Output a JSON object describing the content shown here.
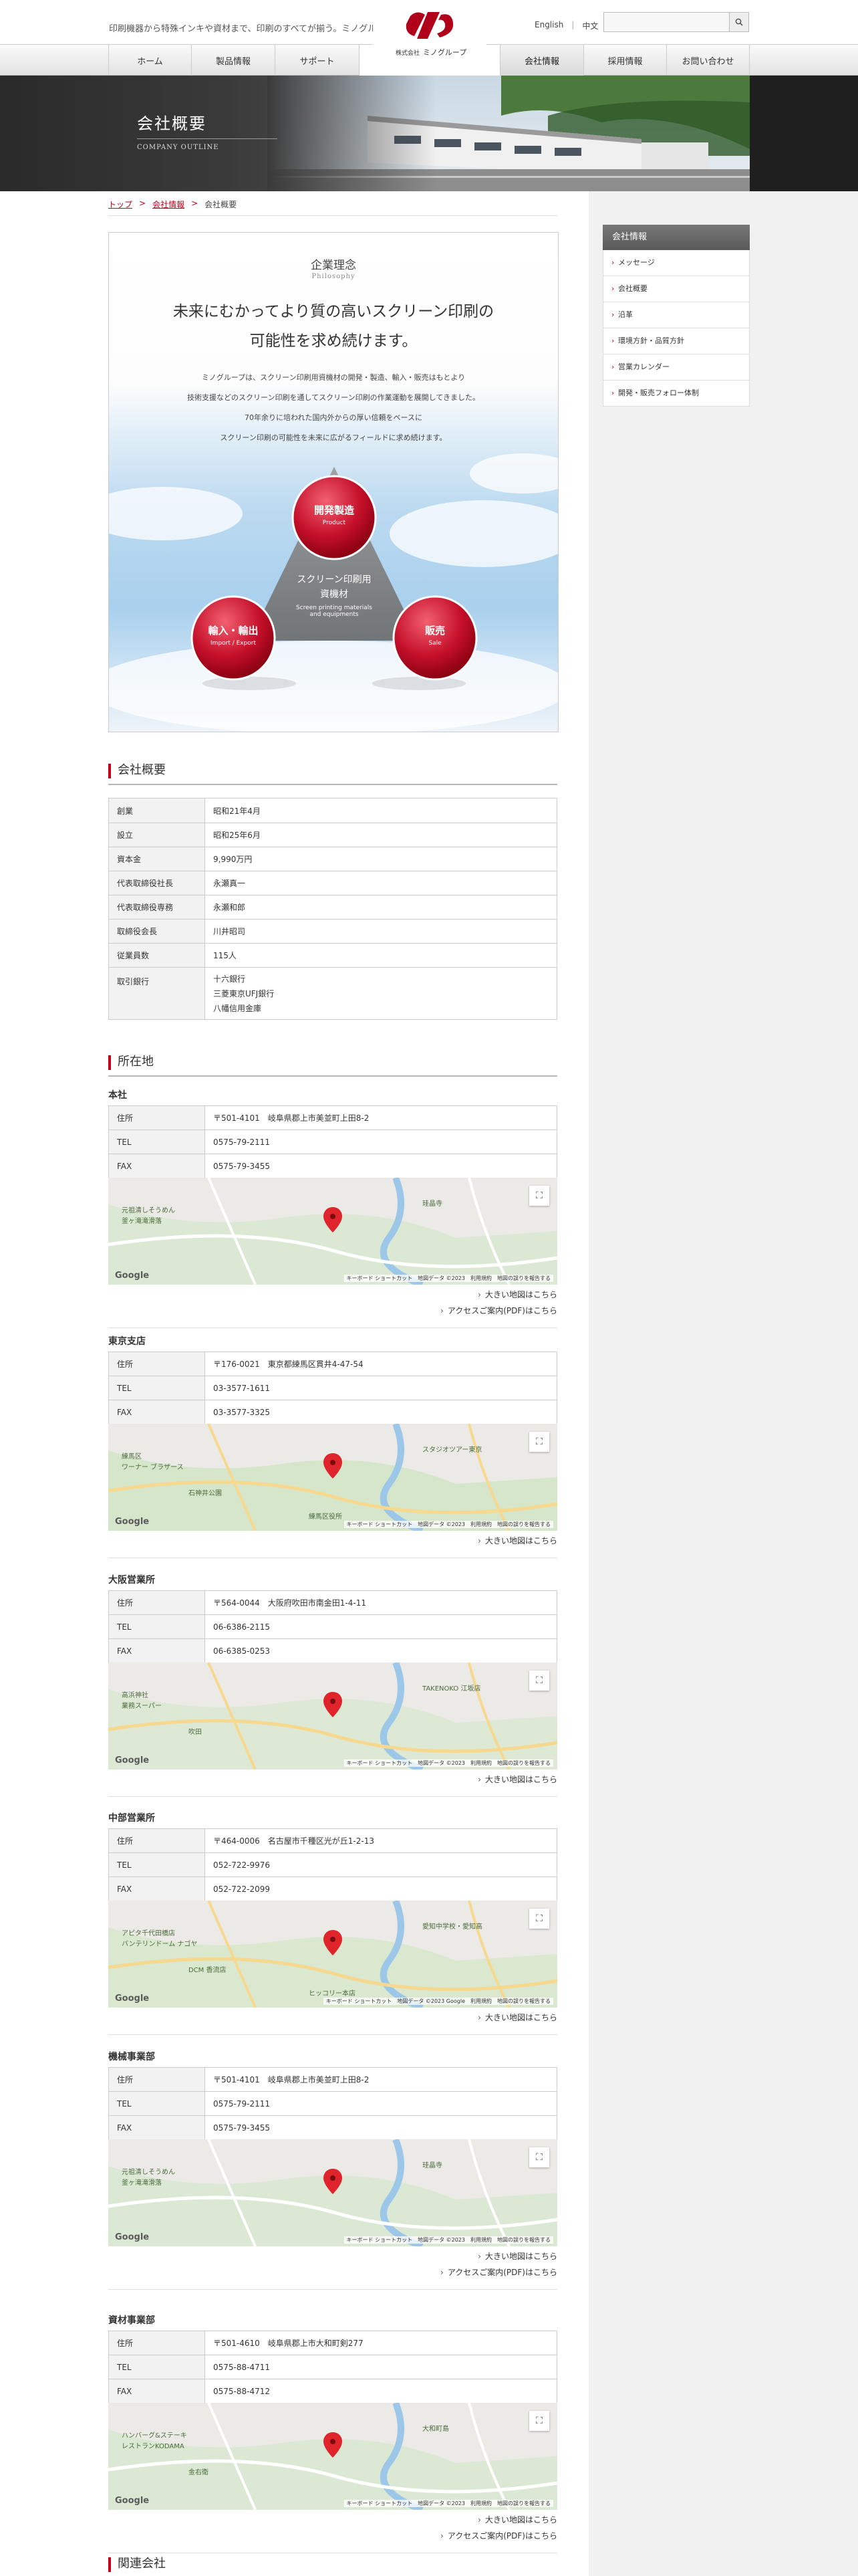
{
  "header": {
    "tagline": "印刷機器から特殊インキや資材まで、印刷のすべてが揃う。ミノグループ",
    "logo_small": "株式会社",
    "logo_text": "ミノグループ",
    "lang_en": "English",
    "lang_zh": "中文",
    "search_placeholder": ""
  },
  "nav": {
    "items": [
      {
        "label": "ホーム"
      },
      {
        "label": "製品情報"
      },
      {
        "label": "サポート"
      },
      {
        "label": "会社情報"
      },
      {
        "label": "採用情報"
      },
      {
        "label": "お問い合わせ"
      }
    ]
  },
  "hero": {
    "title": "会社概要",
    "subtitle": "COMPANY OUTLINE"
  },
  "breadcrumb": {
    "home": "トップ",
    "parent": "会社情報",
    "current": "会社概要"
  },
  "philosophy": {
    "heading": "企業理念",
    "heading_en": "Philosophy",
    "headline_1": "未来にむかってより質の高いスクリーン印刷の",
    "headline_2": "可能性を求め続けます。",
    "body": [
      "ミノグループは、スクリーン印刷用資機材の開発・製造、輸入・販売はもとより",
      "技術支援などのスクリーン印刷を通してスクリーン印刷の作業運動を展開してきました。",
      "70年余りに培われた国内外からの厚い信頼をベースに",
      "スクリーン印刷の可能性を未来に広がるフィールドに求め続けます。"
    ],
    "center_1": "スクリーン印刷用",
    "center_2": "資機材",
    "center_en_1": "Screen printing materials",
    "center_en_2": "and equipments",
    "circle_top": "開発製造",
    "circle_top_en": "Product",
    "circle_left": "輸入・輸出",
    "circle_left_en": "Import / Export",
    "circle_right": "販売",
    "circle_right_en": "Sale"
  },
  "company": {
    "heading": "会社概要",
    "rows": [
      {
        "k": "創業",
        "v": [
          "昭和21年4月"
        ]
      },
      {
        "k": "設立",
        "v": [
          "昭和25年6月"
        ]
      },
      {
        "k": "資本金",
        "v": [
          "9,990万円"
        ]
      },
      {
        "k": "代表取締役社長",
        "v": [
          "永瀬真一"
        ]
      },
      {
        "k": "代表取締役専務",
        "v": [
          "永瀬和郎"
        ]
      },
      {
        "k": "取締役会長",
        "v": [
          "川井昭司"
        ]
      },
      {
        "k": "従業員数",
        "v": [
          "115人"
        ]
      },
      {
        "k": "取引銀行",
        "v": [
          "十六銀行",
          "三菱東京UFJ銀行",
          "八幡信用金庫"
        ]
      }
    ]
  },
  "location": {
    "heading": "所在地",
    "map_google": "Google",
    "map_footer": "キーボード ショートカット　地図データ ©2023　利用規約　地図の誤りを報告する",
    "map_footer_alt": "キーボード ショートカット　地図データ ©2023 Google　利用規約　地図の誤りを報告する",
    "branches": [
      {
        "title": "本社",
        "address": "〒501-4101　岐阜県郡上市美並町上田8-2",
        "tel": "0575-79-2111",
        "fax": "0575-79-3455",
        "labels": [
          "元祖清しそうめん",
          "釜ヶ滝滝滑落",
          "珪晶寺"
        ],
        "links": [
          "大きい地図はこちら",
          "アクセスご案内(PDF)はこちら"
        ]
      },
      {
        "title": "東京支店",
        "address": "〒176-0021　東京都練馬区貫井4-47-54",
        "tel": "03-3577-1611",
        "fax": "03-3577-3325",
        "labels": [
          "練馬区",
          "ワーナー ブラザース",
          "スタジオツアー東京",
          "石神井公園",
          "練馬区役所"
        ],
        "links": [
          "大きい地図はこちら"
        ]
      },
      {
        "title": "大阪営業所",
        "address": "〒564-0044　大阪府吹田市南金田1-4-11",
        "tel": "06-6386-2115",
        "fax": "06-6385-0253",
        "labels": [
          "高浜神社",
          "業務スーパー",
          "TAKENOKO 江坂店",
          "吹田"
        ],
        "links": [
          "大きい地図はこちら"
        ]
      },
      {
        "title": "中部営業所",
        "address": "〒464-0006　名古屋市千種区光が丘1-2-13",
        "tel": "052-722-9976",
        "fax": "052-722-2099",
        "labels": [
          "アピタ千代田橋店",
          "バンテリンドーム ナゴヤ",
          "愛知中学校・愛知高",
          "DCM 香流店",
          "ヒッコリー本店"
        ],
        "links": [
          "大きい地図はこちら"
        ]
      },
      {
        "title": "機械事業部",
        "address": "〒501-4101　岐阜県郡上市美並町上田8-2",
        "tel": "0575-79-2111",
        "fax": "0575-79-3455",
        "labels": [
          "元祖清しそうめん",
          "釜ヶ滝滝滑落",
          "珪晶寺"
        ],
        "links": [
          "大きい地図はこちら",
          "アクセスご案内(PDF)はこちら"
        ]
      },
      {
        "title": "資材事業部",
        "address": "〒501-4610　岐阜県郡上市大和町剣277",
        "tel": "0575-88-4711",
        "fax": "0575-88-4712",
        "labels": [
          "ハンバーグ&ステーキ",
          "レストランKODAMA",
          "大和町島",
          "金右衛"
        ],
        "links": [
          "大きい地図はこちら",
          "アクセスご案内(PDF)はこちら"
        ]
      }
    ],
    "key_address": "住所",
    "key_tel": "TEL",
    "key_fax": "FAX"
  },
  "sidebar": {
    "heading": "会社情報",
    "items": [
      {
        "label": "メッセージ"
      },
      {
        "label": "会社概要"
      },
      {
        "label": "沿革"
      },
      {
        "label": "環境方針・品質方針"
      },
      {
        "label": "営業カレンダー"
      },
      {
        "label": "開発・販売フォロー体制"
      }
    ]
  },
  "bottom": {
    "heading": "関連会社"
  },
  "colors": {
    "accent": "#c0001a",
    "sidebar_bg": "#f1f1f1"
  }
}
